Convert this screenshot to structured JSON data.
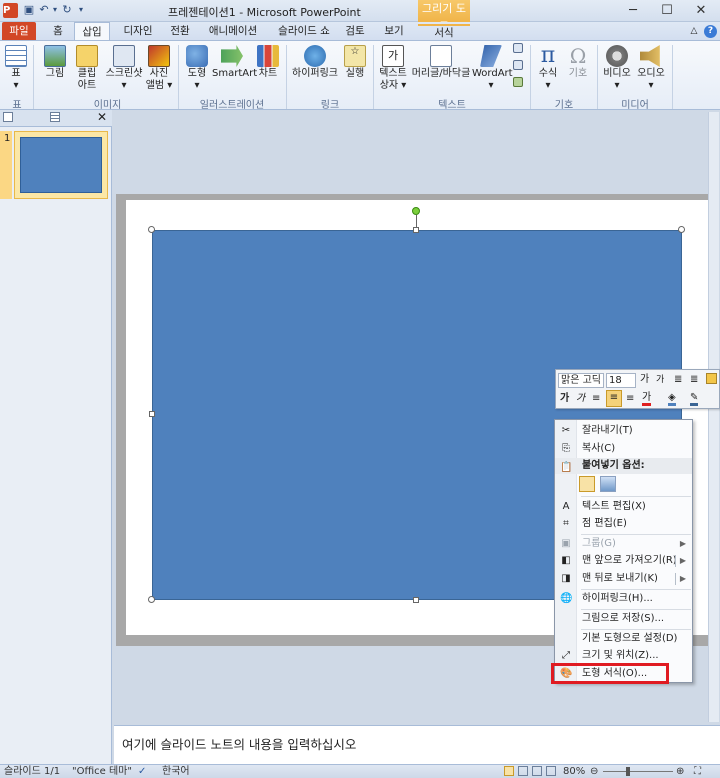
{
  "window": {
    "title": "프레젠테이션1 - Microsoft PowerPoint",
    "context_tab": "그리기 도구"
  },
  "tabs": [
    {
      "label": "파일"
    },
    {
      "label": "홈"
    },
    {
      "label": "삽입"
    },
    {
      "label": "디자인"
    },
    {
      "label": "전환"
    },
    {
      "label": "애니메이션"
    },
    {
      "label": "슬라이드 쇼"
    },
    {
      "label": "검토"
    },
    {
      "label": "보기"
    },
    {
      "label": "서식"
    }
  ],
  "ribbon": {
    "buttons": [
      {
        "label": "표",
        "sub": "▾"
      },
      {
        "label": "그림"
      },
      {
        "label": "클립",
        "sub": "아트"
      },
      {
        "label": "스크린샷",
        "sub": "▾"
      },
      {
        "label": "사진",
        "sub": "앨범 ▾"
      },
      {
        "label": "도형",
        "sub": "▾"
      },
      {
        "label": "SmartArt"
      },
      {
        "label": "차트"
      },
      {
        "label": "하이퍼링크"
      },
      {
        "label": "실행"
      },
      {
        "label": "텍스트",
        "sub": "상자 ▾"
      },
      {
        "label": "머리글/바닥글"
      },
      {
        "label": "WordArt",
        "sub": "▾"
      },
      {
        "label": "수식",
        "sub": "▾"
      },
      {
        "label": "기호"
      },
      {
        "label": "비디오",
        "sub": "▾"
      },
      {
        "label": "오디오",
        "sub": "▾"
      }
    ],
    "groups": [
      "표",
      "이미지",
      "일러스트레이션",
      "링크",
      "텍스트",
      "기호",
      "미디어"
    ]
  },
  "mini_toolbar": {
    "font": "맑은 고딕",
    "size": "18",
    "bold": "가",
    "italic": "가"
  },
  "context_menu": {
    "items": [
      {
        "label": "잘라내기(T)",
        "icon": "✂"
      },
      {
        "label": "복사(C)",
        "icon": "⎘"
      },
      {
        "label": "붙여넣기 옵션:",
        "icon": "📋"
      },
      {
        "label": "텍스트 편집(X)",
        "icon": "A"
      },
      {
        "label": "점 편집(E)",
        "icon": "⌗"
      },
      {
        "label": "그룹(G)",
        "icon": "▣"
      },
      {
        "label": "맨 앞으로 가져오기(R)",
        "icon": "◧"
      },
      {
        "label": "맨 뒤로 보내기(K)",
        "icon": "◨"
      },
      {
        "label": "하이퍼링크(H)...",
        "icon": "🌐"
      },
      {
        "label": "그림으로 저장(S)...",
        "icon": ""
      },
      {
        "label": "기본 도형으로 설정(D)",
        "icon": ""
      },
      {
        "label": "크기 및 위치(Z)...",
        "icon": "⤢"
      },
      {
        "label": "도형 서식(O)...",
        "icon": "🎨"
      }
    ]
  },
  "notes": {
    "placeholder": "여기에 슬라이드 노트의 내용을 입력하십시오"
  },
  "panel": {
    "slide_number": "1"
  },
  "status": {
    "slide": "슬라이드 1/1",
    "theme": "\"Office 테마\"",
    "language": "한국어",
    "zoom": "80%"
  }
}
